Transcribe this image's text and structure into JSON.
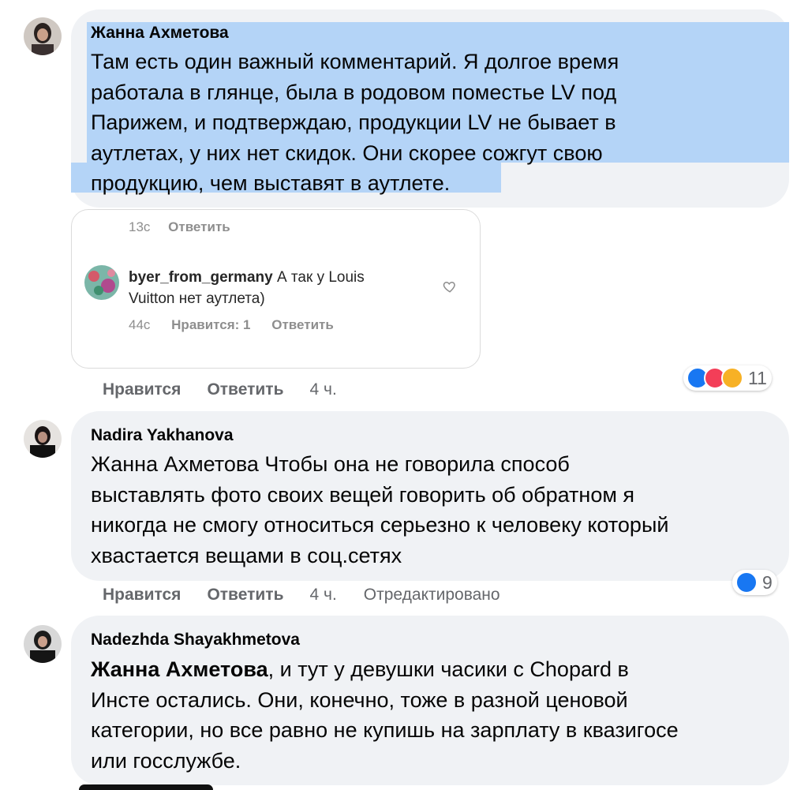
{
  "comments": [
    {
      "author": "Жанна Ахметова",
      "text_lines": [
        "Там есть один важный комментарий. Я долгое время",
        "работала в глянце, была в родовом поместье LV под",
        "Парижем, и подтверждаю, продукции LV не бывает в",
        "аутлетах, у них нет скидок. Они скорее сожгут свою",
        "продукцию, чем выставят в аутлете."
      ],
      "like_label": "Нравится",
      "reply_label": "Ответить",
      "time": "4 ч.",
      "reaction_count": "11",
      "reaction_icons": [
        "like-icon",
        "love-icon",
        "wow-icon"
      ]
    },
    {
      "author": "Nadira Yakhanova",
      "text_lines": [
        "Жанна Ахметова Чтобы она не говорила способ",
        "выставлять фото своих вещей говорить об обратном я",
        "никогда не смогу относиться серьезно к человеку который",
        "хвастается вещами в соц.сетях"
      ],
      "like_label": "Нравится",
      "reply_label": "Ответить",
      "time": "4 ч.",
      "edited": "Отредактировано",
      "reaction_count": "9",
      "reaction_icons": [
        "like-icon"
      ]
    },
    {
      "author": "Nadezhda Shayakhmetova",
      "mention": "Жанна Ахметова",
      "text_first_rest": ", и тут у девушки часики с Chopard в",
      "text_lines": [
        "Инсте остались. Они, конечно, тоже в разной ценовой",
        "категории, но все равно не купишь на зарплату в квазигосе",
        "или госслужбе."
      ]
    }
  ],
  "embed": {
    "top_time": "13с",
    "top_reply": "Ответить",
    "ig_user": "byer_from_germany",
    "ig_text_1": " А так у Louis",
    "ig_text_2": "Vuitton нет аутлета)",
    "ig_time": "44с",
    "ig_likes": "Нравится: 1",
    "ig_reply": "Ответить"
  }
}
